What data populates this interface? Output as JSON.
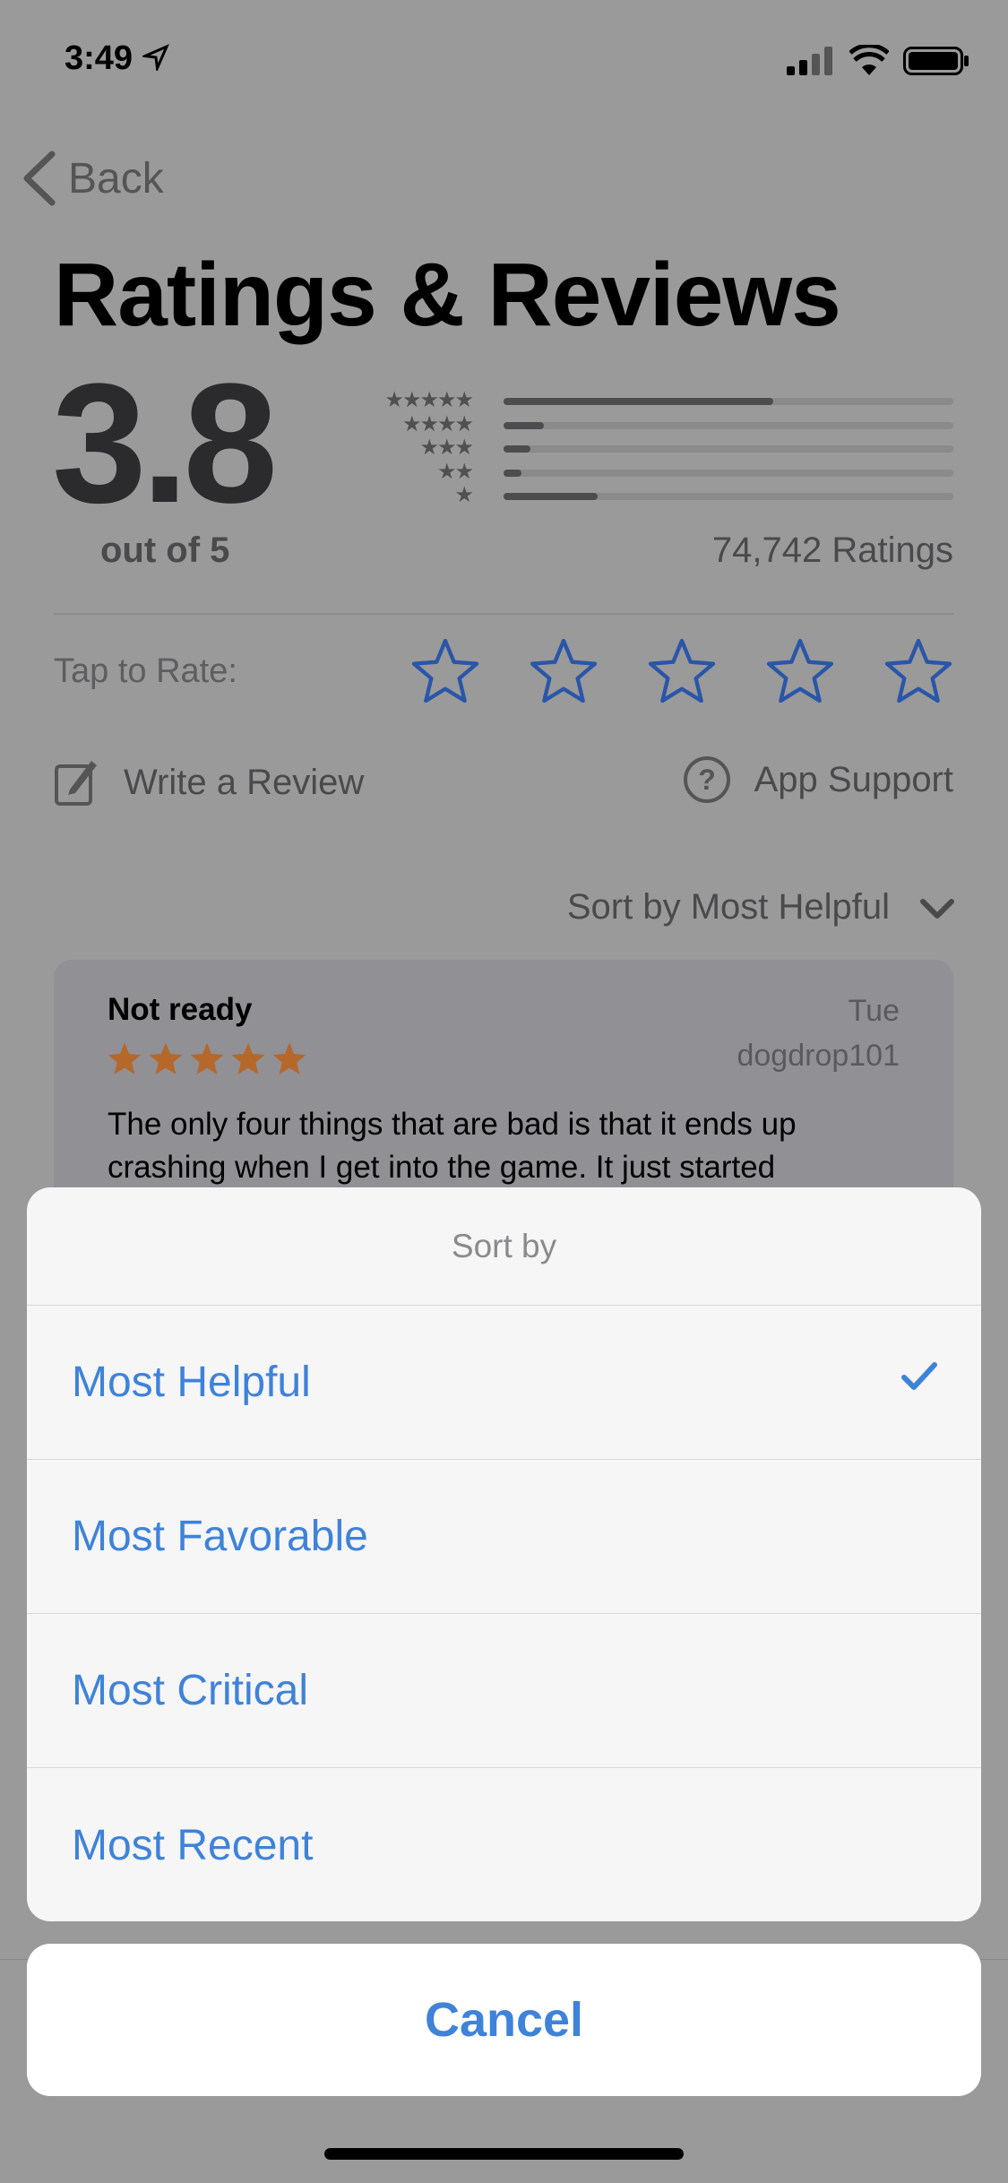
{
  "status": {
    "time": "3:49",
    "icons": [
      "location-arrow-icon",
      "signal-icon",
      "wifi-icon",
      "battery-icon"
    ]
  },
  "nav": {
    "back_label": "Back"
  },
  "header": {
    "title": "Ratings & Reviews"
  },
  "summary": {
    "average": "3.8",
    "out_of": "out of 5",
    "total_ratings": "74,742 Ratings",
    "distribution": [
      {
        "stars": "★★★★★",
        "fraction": 0.6
      },
      {
        "stars": "★★★★",
        "fraction": 0.09
      },
      {
        "stars": "★★★",
        "fraction": 0.06
      },
      {
        "stars": "★★",
        "fraction": 0.04
      },
      {
        "stars": "★",
        "fraction": 0.21
      }
    ]
  },
  "rate": {
    "label": "Tap to Rate:",
    "stars": 5
  },
  "actions": {
    "write_review": "Write a Review",
    "app_support": "App Support"
  },
  "sort": {
    "label": "Sort by Most Helpful"
  },
  "review": {
    "title": "Not ready",
    "date": "Tue",
    "author": "dogdrop101",
    "rating": 5,
    "body": "The only four things that are bad is that it ends up crashing when I get into the game. It just started"
  },
  "sheet": {
    "title": "Sort by",
    "options": [
      {
        "label": "Most Helpful",
        "selected": true
      },
      {
        "label": "Most Favorable"
      },
      {
        "label": "Most Critical"
      },
      {
        "label": "Most Recent"
      }
    ],
    "cancel": "Cancel"
  },
  "colors": {
    "accent": "#3f83d8",
    "review_star": "#b5682a",
    "rate_star": "#2a56a8"
  }
}
